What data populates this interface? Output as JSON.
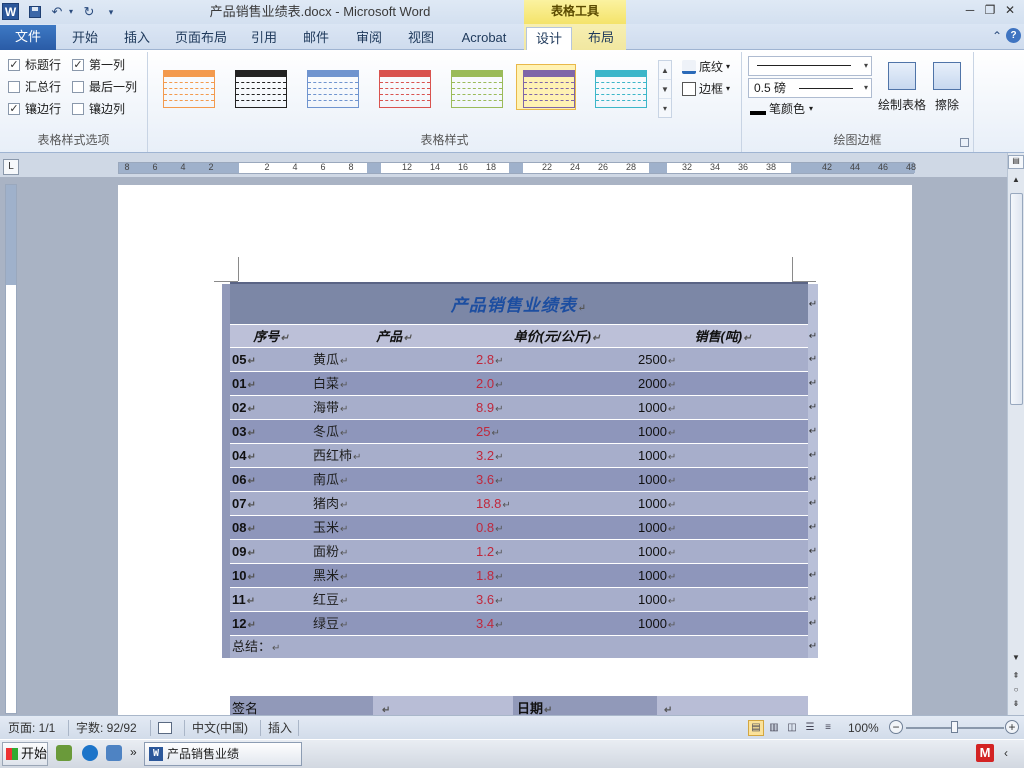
{
  "window": {
    "app_icon_letter": "W",
    "title": "产品销售业绩表.docx - Microsoft Word",
    "context_tool_header": "表格工具",
    "controls": [
      "─",
      "❐",
      "✕"
    ]
  },
  "quick_access": {
    "undo_glyph": "↶",
    "redo_glyph": "↻",
    "dropdown_glyph": "▾",
    "customize_glyph": "▾"
  },
  "tabs": {
    "file": "文件",
    "items": [
      "开始",
      "插入",
      "页面布局",
      "引用",
      "邮件",
      "审阅",
      "视图",
      "Acrobat",
      "设计",
      "布局"
    ],
    "active": "设计",
    "minimize_glyph": "⌃",
    "help_glyph": "?"
  },
  "ribbon": {
    "style_options": {
      "label": "表格样式选项",
      "checkboxes": [
        {
          "label": "标题行",
          "checked": true
        },
        {
          "label": "第一列",
          "checked": true
        },
        {
          "label": "汇总行",
          "checked": false
        },
        {
          "label": "最后一列",
          "checked": false
        },
        {
          "label": "镶边行",
          "checked": true
        },
        {
          "label": "镶边列",
          "checked": false
        }
      ]
    },
    "table_styles": {
      "label": "表格样式",
      "swatch_colors": [
        "#f39a4e",
        "#222222",
        "#6f94cf",
        "#d9534f",
        "#9bbb59",
        "#7f66a8",
        "#3cb6c9"
      ],
      "selected_index": 5,
      "shading_label": "底纹",
      "borders_label": "边框"
    },
    "draw_borders": {
      "label": "绘图边框",
      "pen_weight": "0.5 磅",
      "pen_color_label": "笔颜色",
      "draw_table_label": "绘制表格",
      "eraser_label": "擦除"
    }
  },
  "ruler": {
    "numbers": [
      "8",
      "6",
      "4",
      "2",
      "2",
      "4",
      "6",
      "8",
      "12",
      "14",
      "16",
      "18",
      "22",
      "24",
      "26",
      "28",
      "32",
      "34",
      "36",
      "38",
      "42",
      "44",
      "46",
      "48"
    ],
    "corner_glyph": "L"
  },
  "document": {
    "table_title": "产品销售业绩表",
    "headers": [
      "序号",
      "产品",
      "单价(元/公斤)",
      "销售(吨)"
    ],
    "rows": [
      {
        "id": "05",
        "name": "黄瓜",
        "price": "2.8",
        "sales": "2500"
      },
      {
        "id": "01",
        "name": "白菜",
        "price": "2.0",
        "sales": "2000"
      },
      {
        "id": "02",
        "name": "海带",
        "price": "8.9",
        "sales": "1000"
      },
      {
        "id": "03",
        "name": "冬瓜",
        "price": "25",
        "sales": "1000"
      },
      {
        "id": "04",
        "name": "西红柿",
        "price": "3.2",
        "sales": "1000"
      },
      {
        "id": "06",
        "name": "南瓜",
        "price": "3.6",
        "sales": "1000"
      },
      {
        "id": "07",
        "name": "猪肉",
        "price": "18.8",
        "sales": "1000"
      },
      {
        "id": "08",
        "name": "玉米",
        "price": "0.8",
        "sales": "1000"
      },
      {
        "id": "09",
        "name": "面粉",
        "price": "1.2",
        "sales": "1000"
      },
      {
        "id": "10",
        "name": "黑米",
        "price": "1.8",
        "sales": "1000"
      },
      {
        "id": "11",
        "name": "红豆",
        "price": "3.6",
        "sales": "1000"
      },
      {
        "id": "12",
        "name": "绿豆",
        "price": "3.4",
        "sales": "1000"
      }
    ],
    "summary_label": "总结：",
    "sign_label": "签名",
    "date_label": "日期",
    "para_mark": "↵",
    "colors": {
      "title": "#1d4ea0",
      "price": "#c0283c",
      "band_light": "#a7aecb",
      "band_dark": "#8e96bb"
    }
  },
  "status": {
    "page": "页面: 1/1",
    "words": "字数: 92/92",
    "language": "中文(中国)",
    "mode": "插入",
    "zoom": "100%",
    "zoom_minus": "−",
    "zoom_plus": "+"
  },
  "taskbar": {
    "start": "开始",
    "word_task": "产品销售业绩表.docx...",
    "overflow_glyph": "»",
    "tray_m": "M",
    "tray_arrow": "‹"
  }
}
